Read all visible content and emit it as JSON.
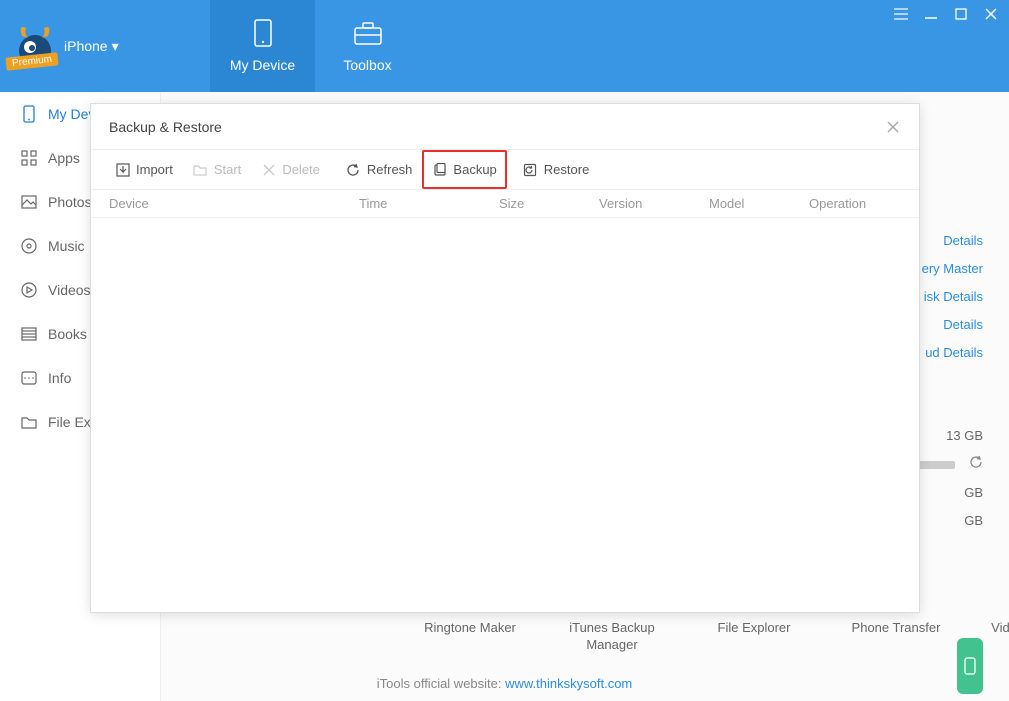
{
  "header": {
    "device_label": "iPhone",
    "premium_badge": "Premium",
    "nav": [
      {
        "label": "My Device"
      },
      {
        "label": "Toolbox"
      }
    ],
    "menu_icon": "menu",
    "minimize_icon": "minimize",
    "maximize_icon": "maximize",
    "close_icon": "close"
  },
  "sidebar": {
    "items": [
      {
        "label": "My Device",
        "active": true
      },
      {
        "label": "Apps"
      },
      {
        "label": "Photos"
      },
      {
        "label": "Music"
      },
      {
        "label": "Videos"
      },
      {
        "label": "Books"
      },
      {
        "label": "Info"
      },
      {
        "label": "File Explorer"
      }
    ]
  },
  "rightpane": {
    "links": [
      "Details",
      "ery Master",
      "isk Details",
      "Details",
      "ud Details"
    ],
    "storage": {
      "line1": "13 GB",
      "line2": "GB",
      "line3": "GB"
    }
  },
  "toolbox": {
    "items": [
      "Ringtone Maker",
      "iTunes Backup Manager",
      "File Explorer",
      "Phone Transfer",
      "Video Converter"
    ]
  },
  "footer": {
    "text": "iTools official website: ",
    "link": "www.thinkskysoft.com"
  },
  "modal": {
    "title": "Backup & Restore",
    "toolbar": {
      "import": "Import",
      "start": "Start",
      "delete": "Delete",
      "refresh": "Refresh",
      "backup": "Backup",
      "restore": "Restore"
    },
    "columns": {
      "device": "Device",
      "time": "Time",
      "size": "Size",
      "version": "Version",
      "model": "Model",
      "operation": "Operation"
    },
    "rows": []
  }
}
